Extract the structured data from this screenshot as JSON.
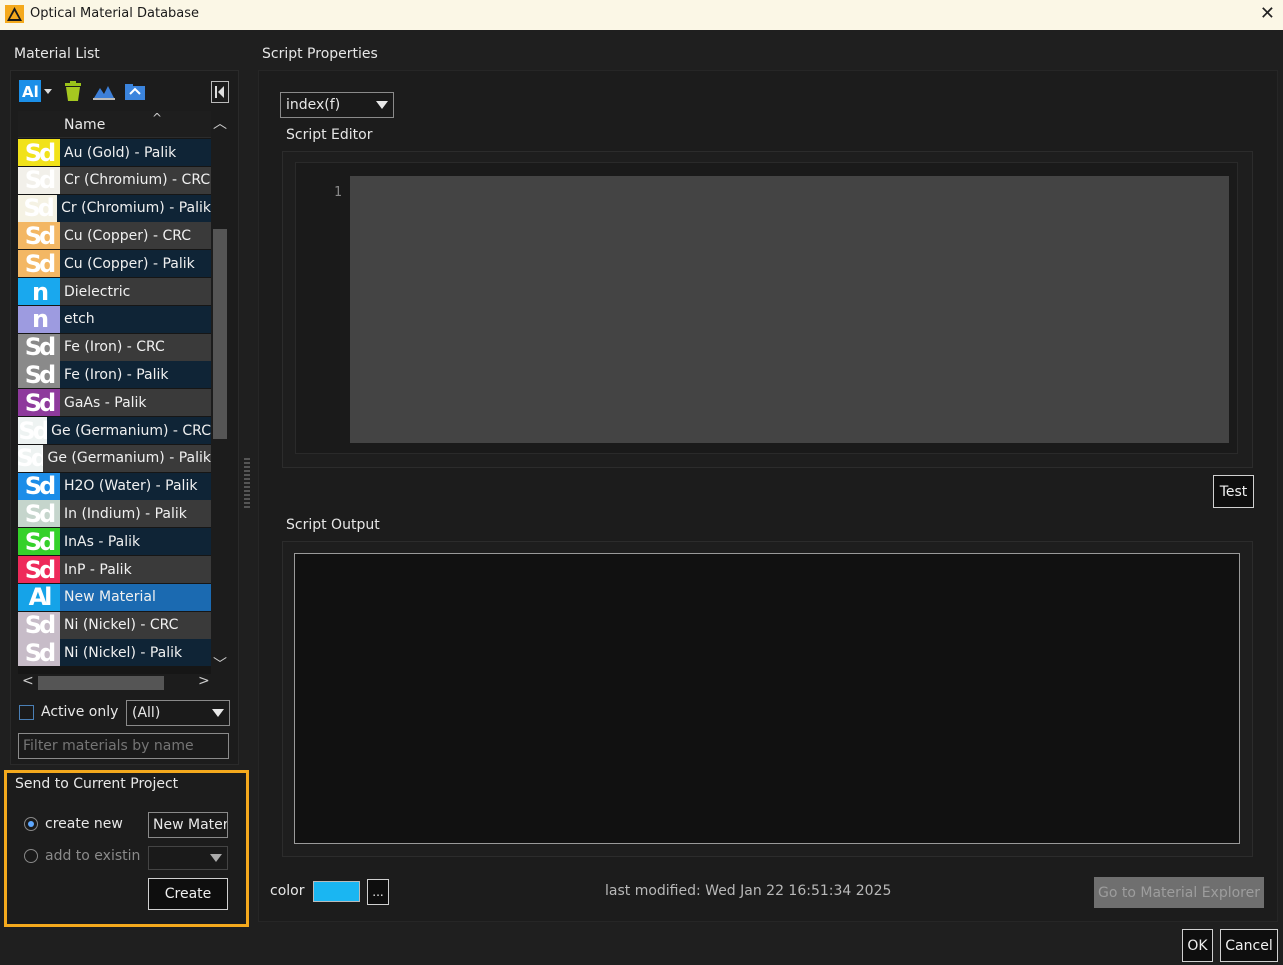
{
  "window": {
    "title": "Optical Material Database"
  },
  "material_list": {
    "label": "Material List",
    "column_name": "Name",
    "items": [
      {
        "swatch": "Sd",
        "color": "#f1e21a",
        "label": "Au (Gold) - Palik",
        "state": "dark"
      },
      {
        "swatch": "Sd",
        "color": "#f2f0ea",
        "label": "Cr (Chromium) - CRC",
        "state": "gray"
      },
      {
        "swatch": "Sd",
        "color": "#f5f2e4",
        "label": "Cr (Chromium) - Palik",
        "state": "dark"
      },
      {
        "swatch": "Sd",
        "color": "#f3b764",
        "label": "Cu (Copper) - CRC",
        "state": "gray"
      },
      {
        "swatch": "Sd",
        "color": "#f3b764",
        "label": "Cu (Copper) - Palik",
        "state": "dark"
      },
      {
        "swatch": "n",
        "color": "#19a8ee",
        "label": "Dielectric",
        "state": "gray"
      },
      {
        "swatch": "n",
        "color": "#9d9be0",
        "label": "etch",
        "state": "dark"
      },
      {
        "swatch": "Sd",
        "color": "#8a8a8a",
        "label": "Fe (Iron) - CRC",
        "state": "gray"
      },
      {
        "swatch": "Sd",
        "color": "#8a8a8a",
        "label": "Fe (Iron) - Palik",
        "state": "dark"
      },
      {
        "swatch": "Sd",
        "color": "#8e3a9c",
        "label": "GaAs - Palik",
        "state": "gray"
      },
      {
        "swatch": "Sd",
        "color": "#eef3f2",
        "label": "Ge (Germanium) - CRC",
        "state": "dark"
      },
      {
        "swatch": "Sd",
        "color": "#eef3f2",
        "label": "Ge (Germanium) - Palik",
        "state": "gray"
      },
      {
        "swatch": "Sd",
        "color": "#1c8de8",
        "label": "H2O (Water) - Palik",
        "state": "dark"
      },
      {
        "swatch": "Sd",
        "color": "#c5d5cc",
        "label": "In (Indium) - Palik",
        "state": "gray"
      },
      {
        "swatch": "Sd",
        "color": "#35d12a",
        "label": "InAs - Palik",
        "state": "dark"
      },
      {
        "swatch": "Sd",
        "color": "#ee2a5a",
        "label": "InP - Palik",
        "state": "gray"
      },
      {
        "swatch": "Al",
        "color": "#15a3e8",
        "label": "New Material",
        "state": "sel"
      },
      {
        "swatch": "Sd",
        "color": "#c7bcc8",
        "label": "Ni (Nickel) - CRC",
        "state": "gray"
      },
      {
        "swatch": "Sd",
        "color": "#c7bcc8",
        "label": "Ni (Nickel) - Palik",
        "state": "dark"
      }
    ],
    "active_only_label": "Active only",
    "filter_value": "(All)",
    "filter_placeholder": "Filter materials by name"
  },
  "send": {
    "label": "Send to Current Project",
    "create_new_label": "create new",
    "create_new_value": "New Materi",
    "add_existing_label": "add to existing",
    "create_button": "Create"
  },
  "script": {
    "properties_label": "Script Properties",
    "function_value": "index(f)",
    "editor_label": "Script Editor",
    "line_number": "1",
    "test_button": "Test",
    "output_label": "Script Output"
  },
  "footer": {
    "color_label": "color",
    "color_value": "#1ab6f2",
    "more_button": "...",
    "last_modified": "last modified: Wed Jan 22 16:51:34 2025",
    "explorer_button": "Go to Material Explorer",
    "ok_button": "OK",
    "cancel_button": "Cancel"
  }
}
